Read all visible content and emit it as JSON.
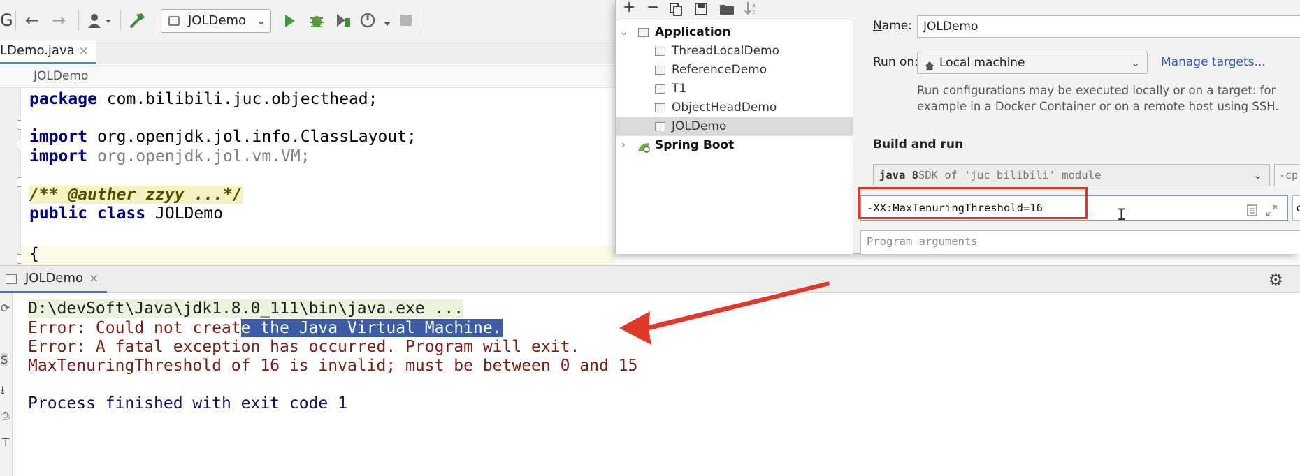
{
  "toolbar": {
    "partial_left_glyph": "G",
    "run_config_label": "JOLDemo"
  },
  "editor": {
    "tab_label": "LDemo.java",
    "tab_close": "×",
    "breadcrumb": "JOLDemo",
    "code": {
      "l1_kw": "package",
      "l1_rest": " com.bilibili.juc.objecthead;",
      "l2_kw": "import",
      "l2_rest": " org.openjdk.jol.info.ClassLayout;",
      "l3_kw": "import",
      "l3_rest": " org.openjdk.jol.vm.VM;",
      "l4_doc": "/** @auther zzyy ...*/",
      "l5_kw": "public class",
      "l5_rest": " JOLDemo",
      "l6": "{"
    }
  },
  "dialog": {
    "tree": {
      "application": "Application",
      "items": [
        "ThreadLocalDemo",
        "ReferenceDemo",
        "T1",
        "ObjectHeadDemo",
        "JOLDemo"
      ],
      "spring_boot": "Spring Boot"
    },
    "name_label_prefix": "N",
    "name_label_rest": "ame:",
    "name_value": "JOLDemo",
    "run_on_label": "Run on:",
    "run_on_value": "Local machine",
    "manage_targets": "Manage targets...",
    "note_line1": "Run configurations may be executed locally or on a target: for",
    "note_line2": "example in a Docker Container or on a remote host using SSH.",
    "build_and_run": "Build and run",
    "jre_bold": "java 8",
    "jre_desc": " SDK of 'juc_bilibili' module",
    "cp_partial": "-cp",
    "vm_options": "-XX:MaxTenuringThreshold=16",
    "main_class_partial": "com",
    "program_args_placeholder": "Program arguments"
  },
  "run_window": {
    "tab_label": "JOLDemo",
    "tab_close": "×",
    "console": {
      "line1": "D:\\devSoft\\Java\\jdk1.8.0_111\\bin\\java.exe ...",
      "line2_plain": "Error: Could not creat",
      "line2_sel": "e the Java Virtual Machine.",
      "line3": "Error: A fatal exception has occurred. Program will exit.",
      "line4": "MaxTenuringThreshold of 16 is invalid; must be between 0 and 15",
      "line5": "Process finished with exit code 1"
    }
  },
  "colors": {
    "annotation_red": "#e0392a",
    "selection_blue": "#3c5da6"
  }
}
